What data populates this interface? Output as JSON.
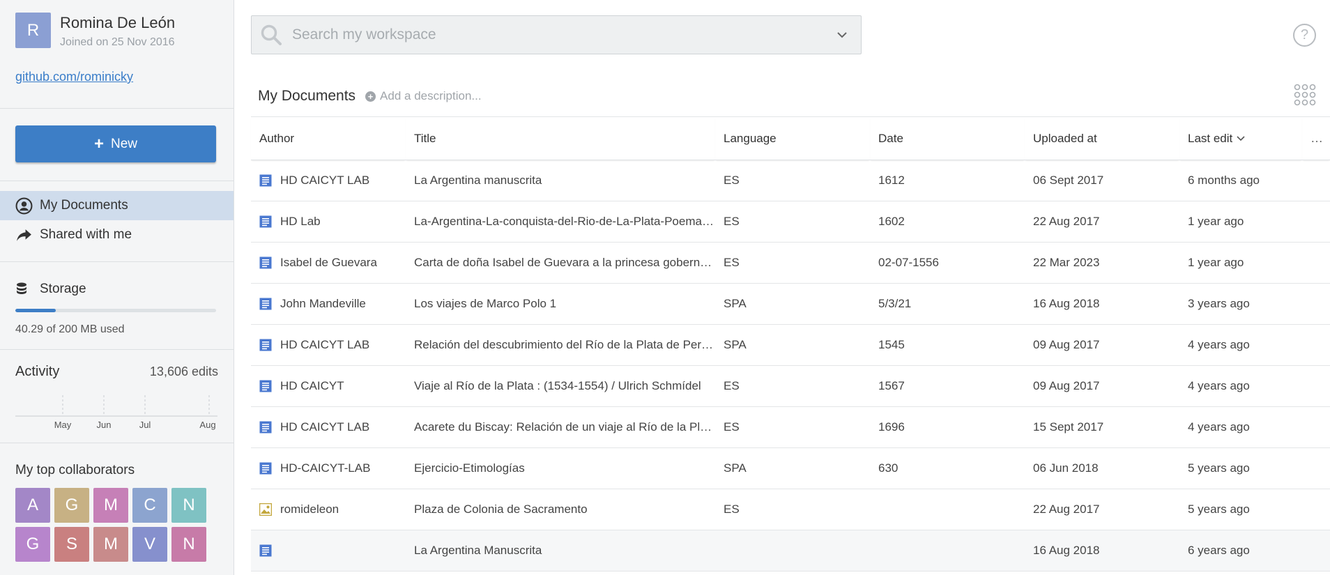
{
  "profile": {
    "initial": "R",
    "name": "Romina De León",
    "joined": "Joined on 25 Nov 2016",
    "link": "github.com/rominicky",
    "avatar_color": "#8b9fd3"
  },
  "new_button": {
    "label": "New",
    "color": "#3d7ec6"
  },
  "nav": {
    "my_documents": "My Documents",
    "shared_with_me": "Shared with me"
  },
  "storage": {
    "title": "Storage",
    "used_text": "40.29 of 200 MB used",
    "used_fraction": 0.2
  },
  "activity": {
    "title": "Activity",
    "count": "13,606 edits",
    "months": [
      "May",
      "Jun",
      "Jul",
      "Aug"
    ]
  },
  "collaborators": {
    "title": "My top collaborators",
    "items": [
      {
        "initial": "A",
        "color": "#a387c7"
      },
      {
        "initial": "G",
        "color": "#c7b184"
      },
      {
        "initial": "M",
        "color": "#c680b7"
      },
      {
        "initial": "C",
        "color": "#8ca4cf"
      },
      {
        "initial": "N",
        "color": "#7fc2c3"
      },
      {
        "initial": "G",
        "color": "#b785cc"
      },
      {
        "initial": "S",
        "color": "#c98080"
      },
      {
        "initial": "M",
        "color": "#c88b8b"
      },
      {
        "initial": "V",
        "color": "#8690cd"
      },
      {
        "initial": "N",
        "color": "#c77ba8"
      }
    ]
  },
  "search": {
    "placeholder": "Search my workspace"
  },
  "help_label": "?",
  "documents": {
    "title": "My Documents",
    "add_description": "Add a description...",
    "columns": {
      "author": "Author",
      "title": "Title",
      "language": "Language",
      "date": "Date",
      "uploaded": "Uploaded at",
      "last_edit": "Last edit",
      "more": "…"
    },
    "rows": [
      {
        "icon": "text",
        "author": "HD CAICYT LAB",
        "title": "La Argentina manuscrita",
        "language": "ES",
        "date": "1612",
        "uploaded": "06 Sept 2017",
        "last_edit": "6 months ago"
      },
      {
        "icon": "text",
        "author": "HD Lab",
        "title": "La-Argentina-La-conquista-del-Rio-de-La-Plata-Poema-Lit",
        "language": "ES",
        "date": "1602",
        "uploaded": "22 Aug 2017",
        "last_edit": "1 year ago"
      },
      {
        "icon": "text",
        "author": "Isabel de Guevara",
        "title": "Carta de doña Isabel de Guevara a la princesa gobernadora",
        "language": "ES",
        "date": "02-07-1556",
        "uploaded": "22 Mar 2023",
        "last_edit": "1 year ago"
      },
      {
        "icon": "text",
        "author": "John Mandeville",
        "title": "Los viajes de Marco Polo 1",
        "language": "SPA",
        "date": "5/3/21",
        "uploaded": "16 Aug 2018",
        "last_edit": "3 years ago"
      },
      {
        "icon": "text",
        "author": "HD CAICYT LAB",
        "title": "Relación del descubrimiento del Río de la Plata de Pero Hernández",
        "language": "SPA",
        "date": "1545",
        "uploaded": "09 Aug 2017",
        "last_edit": "4 years ago"
      },
      {
        "icon": "text",
        "author": "HD CAICYT",
        "title": "Viaje al Río de la Plata : (1534-1554) / Ulrich Schmídel",
        "language": "ES",
        "date": "1567",
        "uploaded": "09 Aug 2017",
        "last_edit": "4 years ago"
      },
      {
        "icon": "text",
        "author": "HD CAICYT LAB",
        "title": "Acarete du Biscay: Relación de un viaje al Río de la Plata y",
        "language": "ES",
        "date": "1696",
        "uploaded": "15 Sept 2017",
        "last_edit": "4 years ago"
      },
      {
        "icon": "text",
        "author": "HD-CAICYT-LAB",
        "title": "Ejercicio-Etimologías",
        "language": "SPA",
        "date": "630",
        "uploaded": "06 Jun 2018",
        "last_edit": "5 years ago"
      },
      {
        "icon": "image",
        "author": "romideleon",
        "title": "Plaza de Colonia de Sacramento",
        "language": "ES",
        "date": "",
        "uploaded": "22 Aug 2017",
        "last_edit": "5 years ago"
      },
      {
        "icon": "text",
        "author": "",
        "title": "La Argentina Manuscrita",
        "language": "",
        "date": "",
        "uploaded": "16 Aug 2018",
        "last_edit": "6 years ago"
      }
    ]
  }
}
